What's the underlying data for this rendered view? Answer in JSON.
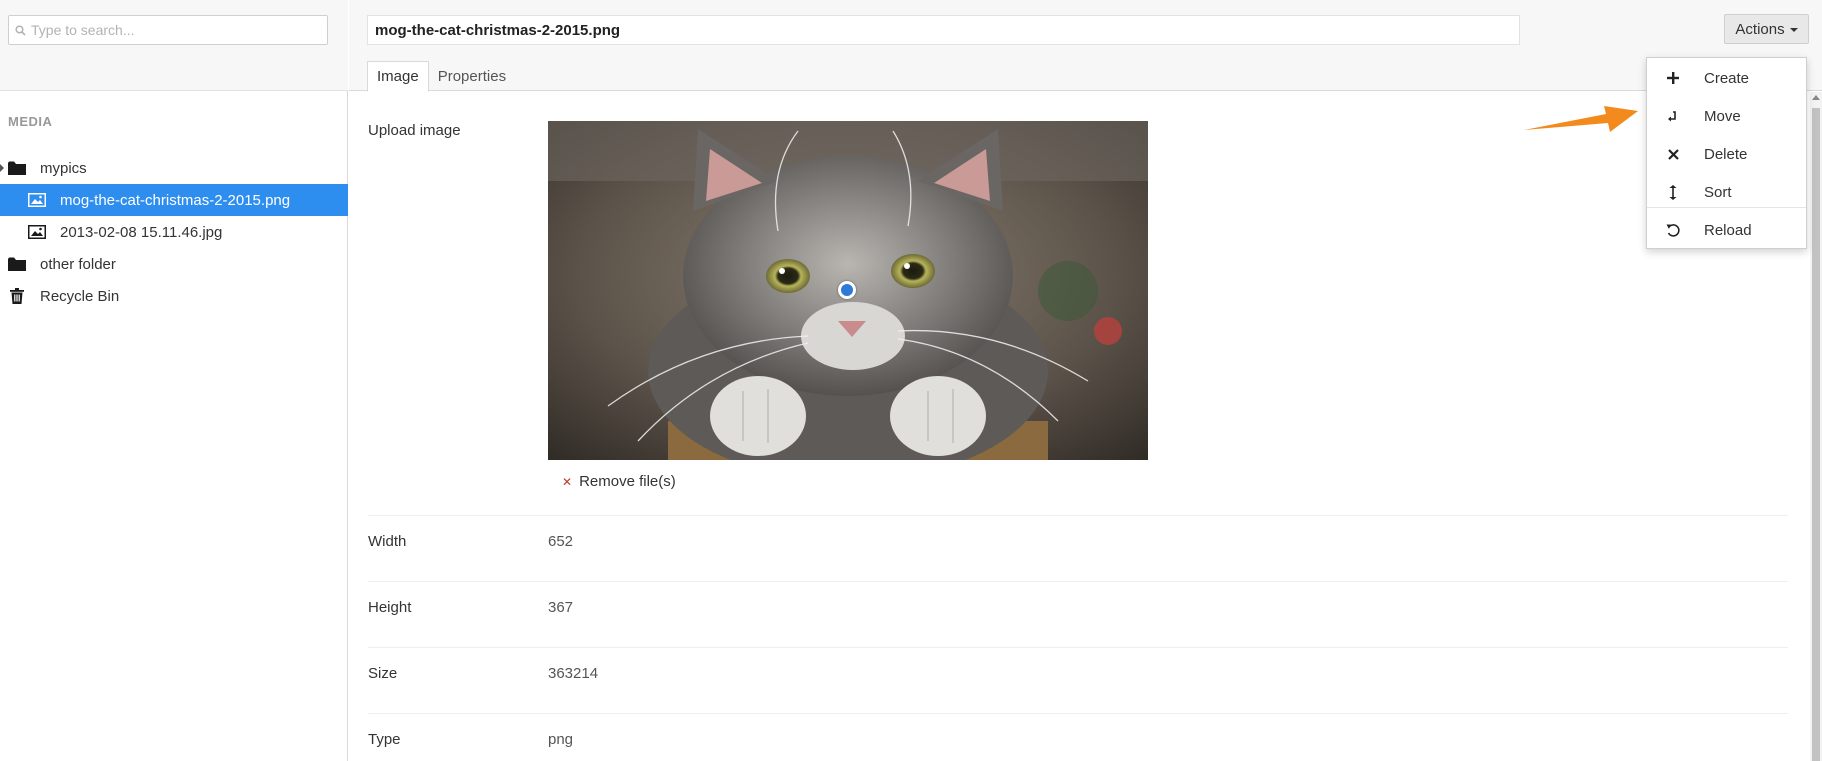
{
  "search": {
    "placeholder": "Type to search..."
  },
  "sidebar": {
    "section_title": "MEDIA",
    "items": [
      {
        "label": "mypics",
        "icon": "folder-icon"
      },
      {
        "label": "mog-the-cat-christmas-2-2015.png",
        "icon": "image-icon",
        "active": true
      },
      {
        "label": "2013-02-08 15.11.46.jpg",
        "icon": "image-icon"
      },
      {
        "label": "other folder",
        "icon": "folder-icon"
      },
      {
        "label": "Recycle Bin",
        "icon": "trash-icon"
      }
    ]
  },
  "header": {
    "name_value": "mog-the-cat-christmas-2-2015.png",
    "actions_label": "Actions"
  },
  "tabs": [
    {
      "label": "Image",
      "active": true
    },
    {
      "label": "Properties"
    }
  ],
  "fields": {
    "upload_label": "Upload image",
    "remove_label": "Remove file(s)",
    "width_label": "Width",
    "width_value": "652",
    "height_label": "Height",
    "height_value": "367",
    "size_label": "Size",
    "size_value": "363214",
    "type_label": "Type",
    "type_value": "png"
  },
  "actions_menu": {
    "items": [
      {
        "label": "Create",
        "icon": "plus-icon"
      },
      {
        "label": "Move",
        "icon": "move-icon"
      },
      {
        "label": "Delete",
        "icon": "close-icon"
      },
      {
        "label": "Sort",
        "icon": "sort-icon"
      },
      {
        "label": "Reload",
        "icon": "reload-icon"
      }
    ]
  },
  "colors": {
    "accent": "#2e8ef0",
    "annotation_arrow": "#f28a1d",
    "remove_x": "#c0392b"
  }
}
